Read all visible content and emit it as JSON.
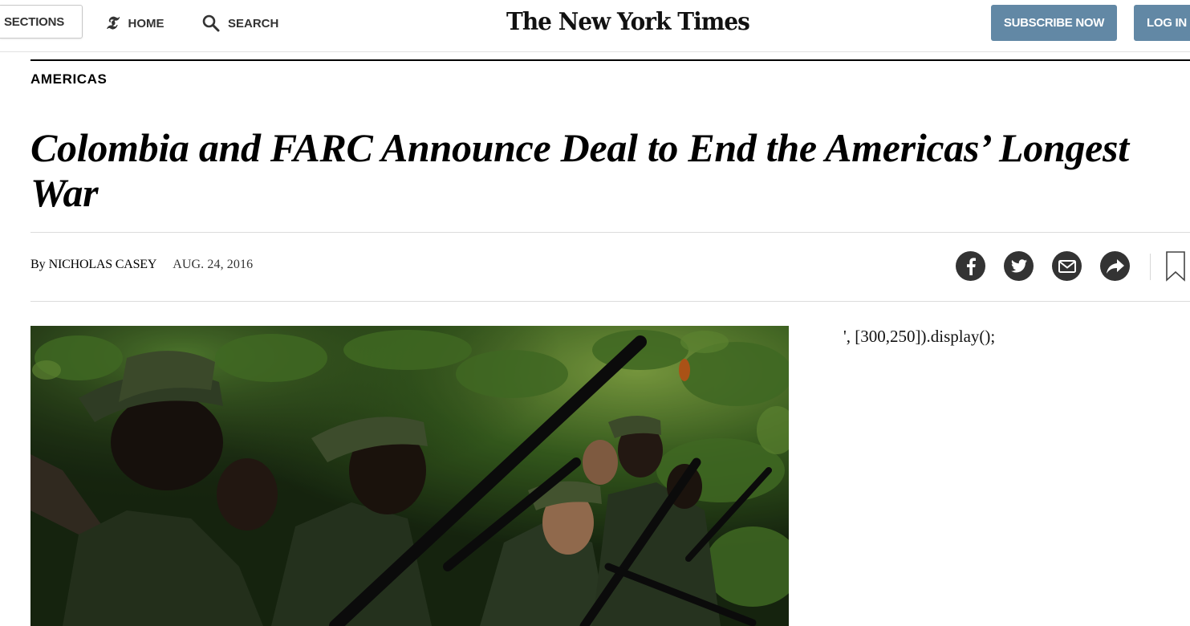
{
  "masthead": {
    "sections_label": "SECTIONS",
    "home_label": "HOME",
    "search_label": "SEARCH",
    "logo_text": "The New York Times",
    "subscribe_label": "SUBSCRIBE NOW",
    "login_label": "LOG IN",
    "accent_color": "#6288a5"
  },
  "article": {
    "kicker": "AMERICAS",
    "headline": "Colombia and FARC Announce Deal to End the Americas’ Longest War",
    "byline_prefix": "By",
    "author": "NICHOLAS CASEY",
    "date": "AUG. 24, 2016",
    "share_icons": [
      "facebook-icon",
      "twitter-icon",
      "email-icon",
      "share-arrow-icon",
      "bookmark-icon"
    ],
    "photo_subject": "soldiers-in-jungle-photo"
  },
  "right_rail": {
    "leftover_text": "', [300,250]).display();"
  }
}
